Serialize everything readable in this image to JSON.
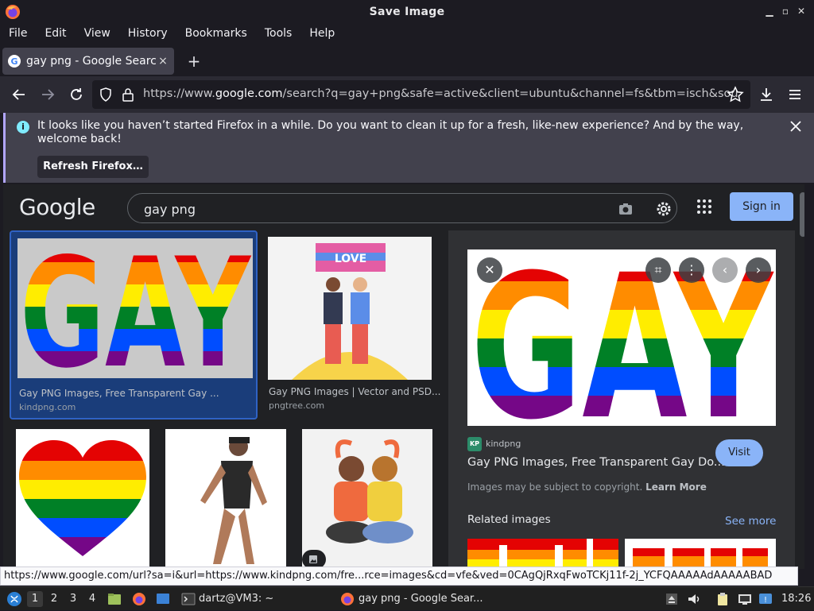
{
  "window": {
    "title": "Save Image"
  },
  "menu": [
    "File",
    "Edit",
    "View",
    "History",
    "Bookmarks",
    "Tools",
    "Help"
  ],
  "tab": {
    "label": "gay png - Google Search",
    "close": "×",
    "new": "+"
  },
  "urlbar": {
    "scheme": "https://www.",
    "host": "google.com",
    "path": "/search?q=gay+png&safe=active&client=ubuntu&channel=fs&tbm=isch&sou"
  },
  "notification": {
    "message": "It looks like you haven’t started Firefox in a while. Do you want to clean it up for a fresh, like-new experience? And by the way, welcome back!",
    "button": "Refresh Firefox…"
  },
  "google": {
    "logo": "Google",
    "query": "gay png",
    "signin": "Sign in"
  },
  "results": [
    {
      "title": "Gay PNG Images, Free Transparent Gay ...",
      "source": "kindpng.com"
    },
    {
      "title": "Gay PNG Images | Vector and PSD...",
      "source": "pngtree.com"
    }
  ],
  "preview": {
    "site": "kindpng",
    "logo_text": "KP",
    "title": "Gay PNG Images, Free Transparent Gay Do...",
    "visit": "Visit",
    "copyright_text": "Images may be subject to copyright.",
    "learn_more": "Learn More",
    "related": "Related images",
    "see_more": "See more"
  },
  "statusbar": {
    "link": "https://www.google.com/url?sa=i&url=https://www.kindpng.com/fre...rce=images&cd=vfe&ved=0CAgQjRxqFwoTCKj11f-2j_YCFQAAAAAdAAAAABAD"
  },
  "taskbar": {
    "workspaces": [
      "1",
      "2",
      "3",
      "4"
    ],
    "terminal": "dartz@VM3: ~",
    "firefox": "gay png - Google Sear...",
    "clock": "18:26"
  },
  "colors": {
    "accent": "#8ab4f8",
    "rainbow": [
      "#e40303",
      "#ff8c00",
      "#ffed00",
      "#008026",
      "#004dff",
      "#750787"
    ]
  }
}
